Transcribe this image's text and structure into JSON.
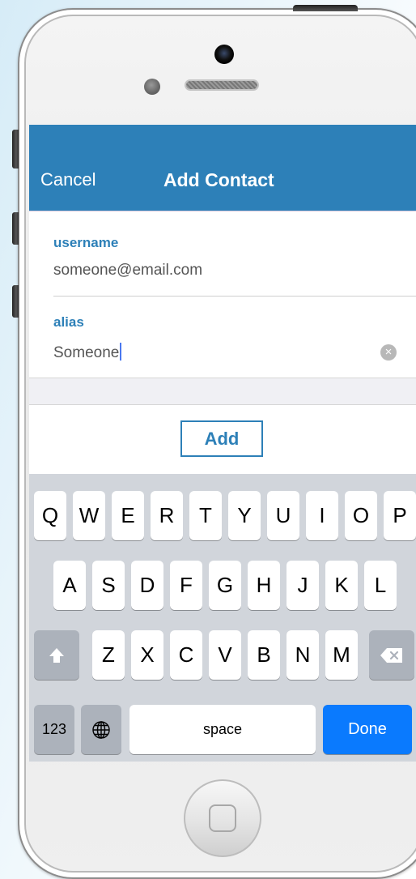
{
  "nav": {
    "cancel_label": "Cancel",
    "title": "Add Contact"
  },
  "form": {
    "username_label": "username",
    "username_value": "someone@email.com",
    "alias_label": "alias",
    "alias_value": "Someone"
  },
  "actions": {
    "add_label": "Add"
  },
  "keyboard": {
    "row1": [
      "Q",
      "W",
      "E",
      "R",
      "T",
      "Y",
      "U",
      "I",
      "O",
      "P"
    ],
    "row2": [
      "A",
      "S",
      "D",
      "F",
      "G",
      "H",
      "J",
      "K",
      "L"
    ],
    "row3": [
      "Z",
      "X",
      "C",
      "V",
      "B",
      "N",
      "M"
    ],
    "numbers_label": "123",
    "space_label": "space",
    "done_label": "Done"
  },
  "icons": {
    "clear": "clear-icon",
    "shift": "shift-icon",
    "backspace": "backspace-icon",
    "globe": "globe-icon"
  },
  "colors": {
    "accent": "#2d80b8",
    "done": "#0a7afe"
  }
}
